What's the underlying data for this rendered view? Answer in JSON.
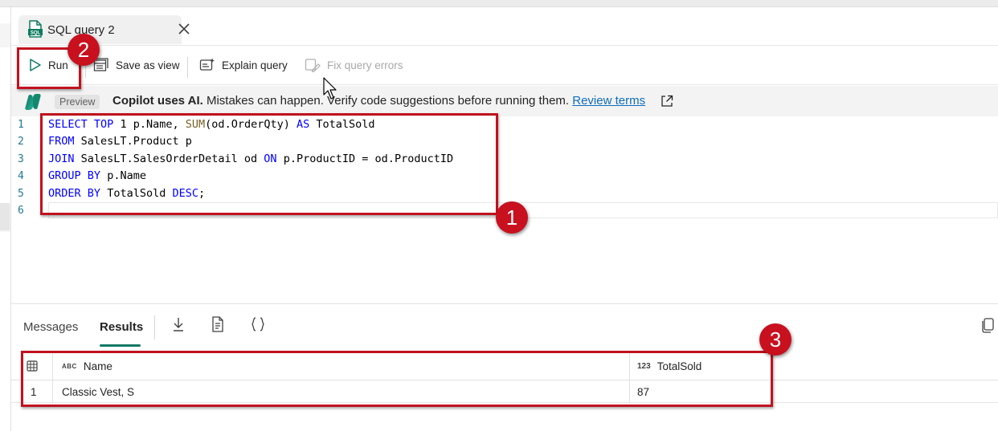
{
  "tab": {
    "title": "SQL query 2",
    "file_icon_text": "SQL"
  },
  "toolbar": {
    "run_label": "Run",
    "save_as_view_label": "Save as view",
    "explain_query_label": "Explain query",
    "fix_query_errors_label": "Fix query errors"
  },
  "banner": {
    "preview_label": "Preview",
    "bold_text": "Copilot uses AI.",
    "message": " Mistakes can happen. Verify code suggestions before running them. ",
    "link_text": "Review terms"
  },
  "editor": {
    "line_numbers": [
      "1",
      "2",
      "3",
      "4",
      "5",
      "6"
    ],
    "lines": [
      "SELECT TOP 1 p.Name, SUM(od.OrderQty) AS TotalSold",
      "FROM SalesLT.Product p",
      "JOIN SalesLT.SalesOrderDetail od ON p.ProductID = od.ProductID",
      "GROUP BY p.Name",
      "ORDER BY TotalSold DESC;",
      ""
    ]
  },
  "results": {
    "tabs": [
      {
        "label": "Messages",
        "active": false
      },
      {
        "label": "Results",
        "active": true
      }
    ],
    "columns": [
      {
        "type_badge": "ABC",
        "label": "Name"
      },
      {
        "type_badge": "123",
        "label": "TotalSold"
      }
    ],
    "rows": [
      {
        "index": "1",
        "name": "Classic Vest, S",
        "total_sold": "87"
      }
    ]
  },
  "annotations": {
    "badge_1": "1",
    "badge_2": "2",
    "badge_3": "3",
    "color": "#c8101e"
  },
  "colors": {
    "keyword": "#0000ff",
    "function": "#795e26",
    "line_number": "#237893",
    "accent": "#117865",
    "link": "#0f6cbd"
  }
}
